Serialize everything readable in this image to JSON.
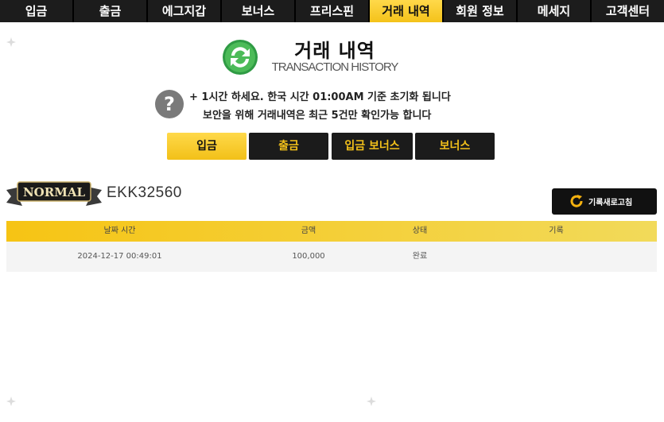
{
  "nav": {
    "tabs": [
      {
        "label": "입금"
      },
      {
        "label": "출금"
      },
      {
        "label": "에그지갑"
      },
      {
        "label": "보너스"
      },
      {
        "label": "프리스핀"
      },
      {
        "label": "거래 내역"
      },
      {
        "label": "회원 정보"
      },
      {
        "label": "메세지"
      },
      {
        "label": "고객센터"
      }
    ],
    "active_index": 5
  },
  "header": {
    "title": "거래 내역",
    "subtitle": "TRANSACTION HISTORY",
    "icon": "refresh-circle-icon"
  },
  "notice": {
    "line1": "+ 1시간 하세요. 한국 시간 01:00AM 기준 초기화 됩니다",
    "line2": "보안을 위해 거래내역은 최근 5건만 확인가능 합니다",
    "icon": "question-icon"
  },
  "subtabs": [
    {
      "label": "입금"
    },
    {
      "label": "출금"
    },
    {
      "label": "입금 보너스"
    },
    {
      "label": "보너스"
    }
  ],
  "user": {
    "level_badge": "NORMAL",
    "username": "EKK32560"
  },
  "refresh_button": {
    "label": "기록새로고침"
  },
  "table": {
    "columns": [
      "날짜 시간",
      "금액",
      "상태",
      "기록"
    ],
    "rows": [
      {
        "datetime": "2024-12-17 00:49:01",
        "amount": "100,000",
        "status": "완료",
        "note": ""
      }
    ]
  },
  "colors": {
    "accent": "#f4c21a",
    "nav_bg": "#1c1c1c",
    "icon_green": "#3aa14a"
  }
}
